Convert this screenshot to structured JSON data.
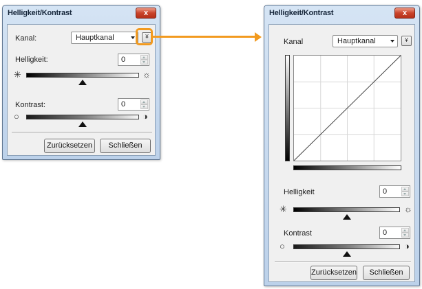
{
  "dialog_small": {
    "title": "Helligkeit/Kontrast",
    "close_label": "x",
    "channel_label": "Kanal:",
    "channel_value": "Hauptkanal",
    "expand_button": "¥",
    "brightness_label": "Helligkeit:",
    "brightness_value": "0",
    "contrast_label": "Kontrast:",
    "contrast_value": "0",
    "reset_button": "Zurücksetzen",
    "close_button": "Schließen"
  },
  "dialog_large": {
    "title": "Helligkeit/Kontrast",
    "close_label": "x",
    "channel_label": "Kanal",
    "channel_value": "Hauptkanal",
    "collapse_button": "¥",
    "brightness_label": "Helligkeit",
    "brightness_value": "0",
    "contrast_label": "Kontrast",
    "contrast_value": "0",
    "reset_button": "Zurücksetzen",
    "close_button": "Schließen"
  },
  "icons": {
    "brightness_low": "✳",
    "brightness_high": "☼",
    "contrast_low": "○",
    "contrast_high": "◑"
  },
  "colors": {
    "highlight": "#f29a1f"
  },
  "slider_levels": {
    "brightness": 0.5,
    "contrast": 0.5
  }
}
